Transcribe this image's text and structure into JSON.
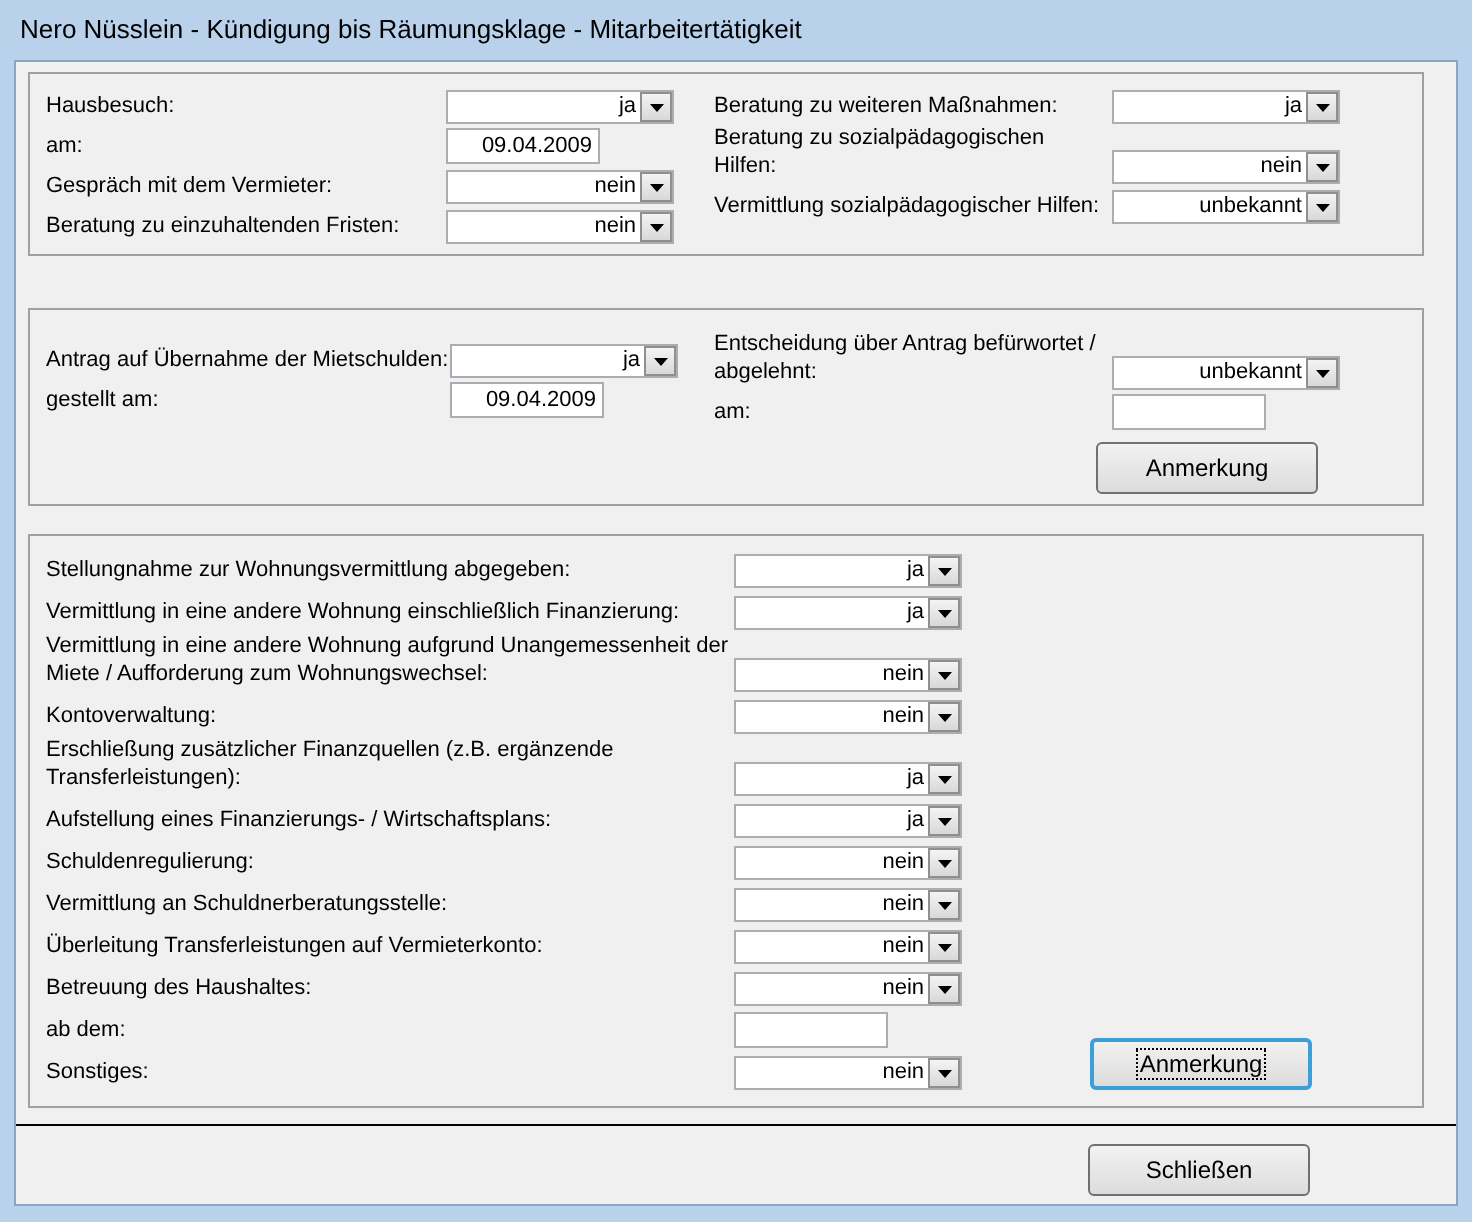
{
  "window": {
    "title": "Nero Nüsslein - Kündigung bis Räumungsklage - Mitarbeitertätigkeit"
  },
  "section_1": {
    "left": [
      {
        "label": "Hausbesuch:",
        "kind": "select",
        "value": "ja"
      },
      {
        "label": "am:",
        "kind": "date",
        "value": "09.04.2009"
      },
      {
        "label": "Gespräch mit dem Vermieter:",
        "kind": "select",
        "value": "nein"
      },
      {
        "label": "Beratung zu einzuhaltenden Fristen:",
        "kind": "select",
        "value": "nein"
      }
    ],
    "right": [
      {
        "label": "Beratung zu weiteren Maßnahmen:",
        "kind": "select",
        "value": "ja"
      },
      {
        "label": "Beratung zu sozialpädagogischen Hilfen:",
        "kind": "select",
        "value": "nein"
      },
      {
        "label": "Vermittlung sozialpädagogischer Hilfen:",
        "kind": "select",
        "value": "unbekannt"
      }
    ]
  },
  "section_2": {
    "left": [
      {
        "label": "Antrag auf Übernahme der Mietschulden:",
        "kind": "select",
        "value": "ja"
      },
      {
        "label": "gestellt am:",
        "kind": "date",
        "value": "09.04.2009"
      }
    ],
    "right": [
      {
        "label": "Entscheidung über Antrag befürwortet / abgelehnt:",
        "kind": "select",
        "value": "unbekannt"
      },
      {
        "label": "am:",
        "kind": "date"
      }
    ],
    "button": {
      "label": "Anmerkung",
      "focused": false
    }
  },
  "section_3": {
    "rows": [
      {
        "label": "Stellungnahme zur Wohnungsvermittlung abgegeben:",
        "kind": "select",
        "value": "ja"
      },
      {
        "label": "Vermittlung in eine andere Wohnung einschließlich Finanzierung:",
        "kind": "select",
        "value": "ja"
      },
      {
        "label": "Vermittlung in eine andere Wohnung aufgrund Unangemessenheit der Miete / Aufforderung zum Wohnungswechsel:",
        "kind": "select",
        "value": "nein"
      },
      {
        "label": "Kontoverwaltung:",
        "kind": "select",
        "value": "nein"
      },
      {
        "label": "Erschließung zusätzlicher Finanzquellen (z.B. ergänzende Transferleistungen):",
        "kind": "select",
        "value": "ja"
      },
      {
        "label": "Aufstellung eines Finanzierungs- / Wirtschaftsplans:",
        "kind": "select",
        "value": "ja"
      },
      {
        "label": "Schuldenregulierung:",
        "kind": "select",
        "value": "nein"
      },
      {
        "label": "Vermittlung an Schuldnerberatungsstelle:",
        "kind": "select",
        "value": "nein"
      },
      {
        "label": "Überleitung Transferleistungen auf Vermieterkonto:",
        "kind": "select",
        "value": "nein"
      },
      {
        "label": "Betreuung des Haushaltes:",
        "kind": "select",
        "value": "nein"
      },
      {
        "label": "ab dem:",
        "kind": "date"
      },
      {
        "label": "Sonstiges:",
        "kind": "select",
        "value": "nein"
      }
    ],
    "button": {
      "label": "Anmerkung",
      "focused": true
    }
  },
  "footer": {
    "button": {
      "label": "Schließen",
      "focused": false
    }
  }
}
